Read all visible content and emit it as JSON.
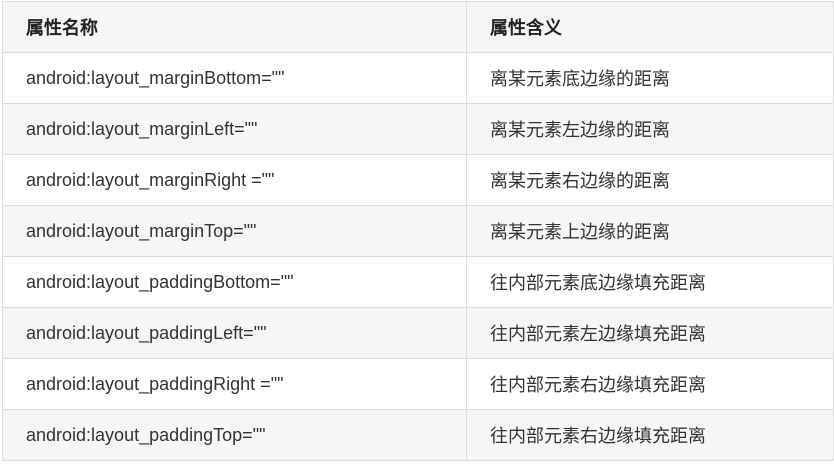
{
  "table": {
    "headers": [
      "属性名称",
      "属性含义"
    ],
    "rows": [
      [
        "android:layout_marginBottom=\"\"",
        "离某元素底边缘的距离"
      ],
      [
        "android:layout_marginLeft=\"\"",
        "离某元素左边缘的距离"
      ],
      [
        "android:layout_marginRight =\"\"",
        "离某元素右边缘的距离"
      ],
      [
        "android:layout_marginTop=\"\"",
        "离某元素上边缘的距离"
      ],
      [
        "android:layout_paddingBottom=\"\"",
        "往内部元素底边缘填充距离"
      ],
      [
        "android:layout_paddingLeft=\"\"",
        "往内部元素左边缘填充距离"
      ],
      [
        "android:layout_paddingRight =\"\"",
        "往内部元素右边缘填充距离"
      ],
      [
        "android:layout_paddingTop=\"\"",
        "往内部元素右边缘填充距离"
      ]
    ]
  },
  "colors": {
    "header_bg": "#f6f6f6",
    "stripe_bg": "#f6f6f6",
    "border": "#dcdcdc",
    "text": "#333333"
  }
}
